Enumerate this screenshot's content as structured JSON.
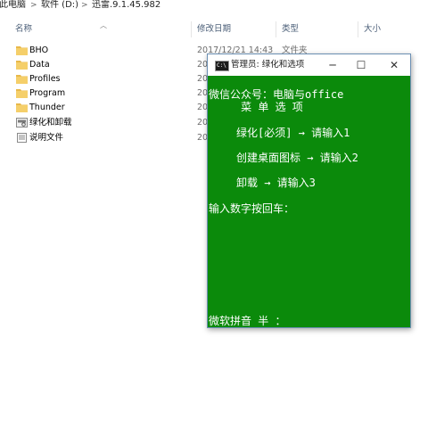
{
  "breadcrumb": {
    "items": [
      "此电脑",
      "软件 (D:)",
      "迅雷.9.1.45.982"
    ],
    "separator": ">"
  },
  "columns": {
    "name": "名称",
    "date": "修改日期",
    "type": "类型",
    "size": "大小"
  },
  "files": [
    {
      "name": "BHO",
      "date": "2017/12/21 14:43",
      "type": "文件夹",
      "icon": "folder-icon"
    },
    {
      "name": "Data",
      "date": "20",
      "type": "",
      "icon": "folder-icon"
    },
    {
      "name": "Profiles",
      "date": "20",
      "type": "",
      "icon": "folder-icon"
    },
    {
      "name": "Program",
      "date": "20",
      "type": "",
      "icon": "folder-icon"
    },
    {
      "name": "Thunder",
      "date": "20",
      "type": "",
      "icon": "folder-icon"
    },
    {
      "name": "绿化和卸载",
      "date": "20",
      "type": "",
      "icon": "batch-file-icon"
    },
    {
      "name": "说明文件",
      "date": "20",
      "type": "",
      "icon": "text-file-icon"
    }
  ],
  "cmd": {
    "title": "管理员:  绿化和选项",
    "lines": [
      "微信公众号：电脑与office",
      "     菜 单 选 项",
      "绿化[必须] → 请输入1",
      "创建桌面图标 → 请输入2",
      "卸载 → 请输入3",
      "输入数字按回车：",
      "微软拼音 半 ："
    ],
    "background": "#0b8a0b",
    "foreground": "#ffffff"
  }
}
